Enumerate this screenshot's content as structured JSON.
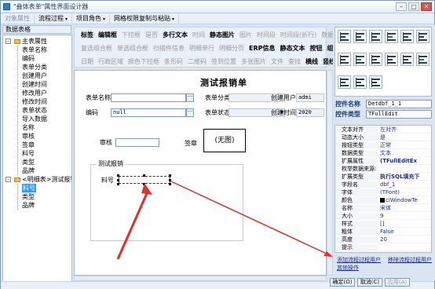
{
  "window": {
    "title": "\"叠体表单\"属性界面设计器"
  },
  "menu": [
    {
      "label": "对象属性",
      "disabled": true
    },
    {
      "label": "流程过程",
      "dropdown": true
    },
    {
      "label": "项目角色",
      "dropdown": true
    },
    {
      "label": "网格权限复制与粘贴",
      "dropdown": true
    }
  ],
  "left_panel": {
    "title": "数据表格",
    "tree": [
      {
        "label": "主表属性",
        "level": 0,
        "expander": "-"
      },
      {
        "label": "表单名称",
        "level": 1
      },
      {
        "label": "编码",
        "level": 1
      },
      {
        "label": "表单分类",
        "level": 1
      },
      {
        "label": "创建用户",
        "level": 1
      },
      {
        "label": "创建时间",
        "level": 1
      },
      {
        "label": "修改用户",
        "level": 1
      },
      {
        "label": "修改时间",
        "level": 1
      },
      {
        "label": "表单状态",
        "level": 1
      },
      {
        "label": "导入数据",
        "level": 1
      },
      {
        "label": "名称",
        "level": 1
      },
      {
        "label": "审核",
        "level": 1
      },
      {
        "label": "签章",
        "level": 1
      },
      {
        "label": "料号",
        "level": 1
      },
      {
        "label": "类型",
        "level": 1
      },
      {
        "label": "品牌",
        "level": 1
      },
      {
        "label": "<明细表>测试报销",
        "level": 0,
        "expander": "-"
      },
      {
        "label": "料号",
        "level": 1,
        "selected": true
      },
      {
        "label": "类型",
        "level": 1
      },
      {
        "label": "品牌",
        "level": 1
      }
    ]
  },
  "toolbar": {
    "row1": [
      {
        "label": "标签",
        "on": true
      },
      {
        "label": "编辑框",
        "on": true
      },
      {
        "label": "下拉框"
      },
      {
        "label": "是否"
      },
      {
        "label": "多行文本",
        "on": true
      },
      {
        "label": "时间"
      },
      {
        "label": "静态图片",
        "on": true
      },
      {
        "label": "图片"
      },
      {
        "label": "时间段"
      },
      {
        "label": "时间段(折行)"
      },
      {
        "label": "数据规"
      }
    ],
    "row2": [
      {
        "label": "复选组合框"
      },
      {
        "label": "单选组合框"
      },
      {
        "label": "扫描件信息"
      },
      {
        "label": "明细单行"
      },
      {
        "label": "明细分页"
      },
      {
        "label": "ERP信息",
        "on": true
      },
      {
        "label": "静态文本",
        "on": true
      },
      {
        "label": "按钮",
        "on": true
      },
      {
        "label": "组合框",
        "on": true
      }
    ],
    "row3": [
      {
        "label": "日期"
      },
      {
        "label": "行政区域"
      },
      {
        "label": "颜色下拉框"
      },
      {
        "label": "条形码"
      },
      {
        "label": "二维码"
      },
      {
        "label": "签到位置"
      },
      {
        "label": "多张图片"
      },
      {
        "label": "文件"
      },
      {
        "label": "查找"
      },
      {
        "label": "横线",
        "on": true
      },
      {
        "label": "竖线",
        "on": true
      }
    ]
  },
  "form": {
    "title": "测试报销单",
    "fields": {
      "form_name_label": "表单名称",
      "form_class_label": "表单分类",
      "creator_label": "创建用户",
      "creator_value": "admi",
      "code_label": "编码",
      "code_value": "null",
      "status_label": "表单状态",
      "created_label": "创建时间",
      "created_value": "2020",
      "review_label": "审核",
      "sign_label": "签章",
      "nopic": "(无图)",
      "group_label": "测试报销",
      "part_label": "料号"
    }
  },
  "right_panel": {
    "ctrl_name_label": "控件名称",
    "ctrl_name_value": "Detdbf_1_1",
    "ctrl_type_label": "控件类型",
    "ctrl_type_value": "TFullEdit",
    "props": [
      {
        "k": "文本对齐",
        "v": "左对齐"
      },
      {
        "k": "动态大小",
        "v": "是"
      },
      {
        "k": "按钮类型",
        "v": "正常"
      },
      {
        "k": "数据类型",
        "v": "文本"
      },
      {
        "k": "扩展属性",
        "v": "(TFullEditEx",
        "exp": "-",
        "b": true
      },
      {
        "k": "枚举数据来源:",
        "v": ""
      },
      {
        "k": "扩展类型",
        "v": "执行SQL填充下",
        "b": true
      },
      {
        "k": "字段名",
        "v": "dbf_1"
      },
      {
        "k": "字体",
        "v": "(TFont)",
        "exp": "-"
      },
      {
        "k": "颜色",
        "v": "clWindowTe",
        "swatch": true
      },
      {
        "k": "名称",
        "v": "宋体"
      },
      {
        "k": "大小",
        "v": "9"
      },
      {
        "k": "样式",
        "v": "[]",
        "exp": "-"
      },
      {
        "k": "粗体",
        "v": "False"
      },
      {
        "k": "高度",
        "v": "20"
      },
      {
        "k": "提示",
        "v": ""
      }
    ],
    "link_add": "添加流程过程用户",
    "link_remove": "移除流程过程用户",
    "link_other": "其他操作"
  },
  "buttons": {
    "ok": "确定(O)",
    "cancel": "取消(C)",
    "apply": "应用(A)"
  },
  "colors": {
    "arrow": "#e0302a",
    "accent": "#3399ff"
  }
}
